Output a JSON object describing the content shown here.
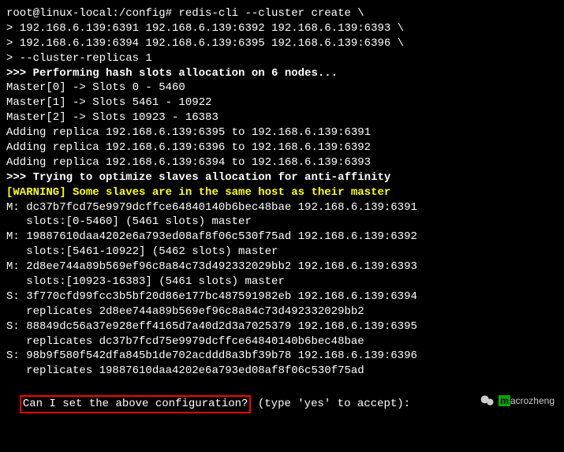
{
  "lines": [
    {
      "segments": [
        {
          "text": "root@linux-local:/config# redis-cli --cluster create \\"
        }
      ]
    },
    {
      "segments": [
        {
          "text": "> 192.168.6.139:6391 192.168.6.139:6392 192.168.6.139:6393 \\"
        }
      ]
    },
    {
      "segments": [
        {
          "text": "> 192.168.6.139:6394 192.168.6.139:6395 192.168.6.139:6396 \\"
        }
      ]
    },
    {
      "segments": [
        {
          "text": "> --cluster-replicas 1"
        }
      ]
    },
    {
      "segments": [
        {
          "text": ">>> Performing hash slots allocation on 6 nodes...",
          "cls": "bold"
        }
      ]
    },
    {
      "segments": [
        {
          "text": "Master[0] -> Slots 0 - 5460"
        }
      ]
    },
    {
      "segments": [
        {
          "text": "Master[1] -> Slots 5461 - 10922"
        }
      ]
    },
    {
      "segments": [
        {
          "text": "Master[2] -> Slots 10923 - 16383"
        }
      ]
    },
    {
      "segments": [
        {
          "text": "Adding replica 192.168.6.139:6395 to 192.168.6.139:6391"
        }
      ]
    },
    {
      "segments": [
        {
          "text": "Adding replica 192.168.6.139:6396 to 192.168.6.139:6392"
        }
      ]
    },
    {
      "segments": [
        {
          "text": "Adding replica 192.168.6.139:6394 to 192.168.6.139:6393"
        }
      ]
    },
    {
      "segments": [
        {
          "text": ">>> Trying to optimize slaves allocation for anti-affinity",
          "cls": "bold"
        }
      ]
    },
    {
      "segments": [
        {
          "text": "[WARNING] Some slaves are in the same host as their master",
          "cls": "yellow"
        }
      ]
    },
    {
      "segments": [
        {
          "text": "M: dc37b7fcd75e9979dcffce64840140b6bec48bae 192.168.6.139:6391"
        }
      ]
    },
    {
      "segments": [
        {
          "text": "   slots:[0-5460] (5461 slots) master"
        }
      ]
    },
    {
      "segments": [
        {
          "text": "M: 19887610daa4202e6a793ed08af8f06c530f75ad 192.168.6.139:6392"
        }
      ]
    },
    {
      "segments": [
        {
          "text": "   slots:[5461-10922] (5462 slots) master"
        }
      ]
    },
    {
      "segments": [
        {
          "text": "M: 2d8ee744a89b569ef96c8a84c73d492332029bb2 192.168.6.139:6393"
        }
      ]
    },
    {
      "segments": [
        {
          "text": "   slots:[10923-16383] (5461 slots) master"
        }
      ]
    },
    {
      "segments": [
        {
          "text": "S: 3f770cfd99fcc3b5bf20d86e177bc487591982eb 192.168.6.139:6394"
        }
      ]
    },
    {
      "segments": [
        {
          "text": "   replicates 2d8ee744a89b569ef96c8a84c73d492332029bb2"
        }
      ]
    },
    {
      "segments": [
        {
          "text": "S: 88849dc56a37e928eff4165d7a40d2d3a7025379 192.168.6.139:6395"
        }
      ]
    },
    {
      "segments": [
        {
          "text": "   replicates dc37b7fcd75e9979dcffce64840140b6bec48bae"
        }
      ]
    },
    {
      "segments": [
        {
          "text": "S: 98b9f580f542dfa845b1de702acddd8a3bf39b78 192.168.6.139:6396"
        }
      ]
    },
    {
      "segments": [
        {
          "text": "   replicates 19887610daa4202e6a793ed08af8f06c530f75ad"
        }
      ]
    }
  ],
  "prompt": {
    "boxed": "Can I set the above configuration?",
    "rest": " (type 'yes' to accept): "
  },
  "watermark": "acrozheng"
}
